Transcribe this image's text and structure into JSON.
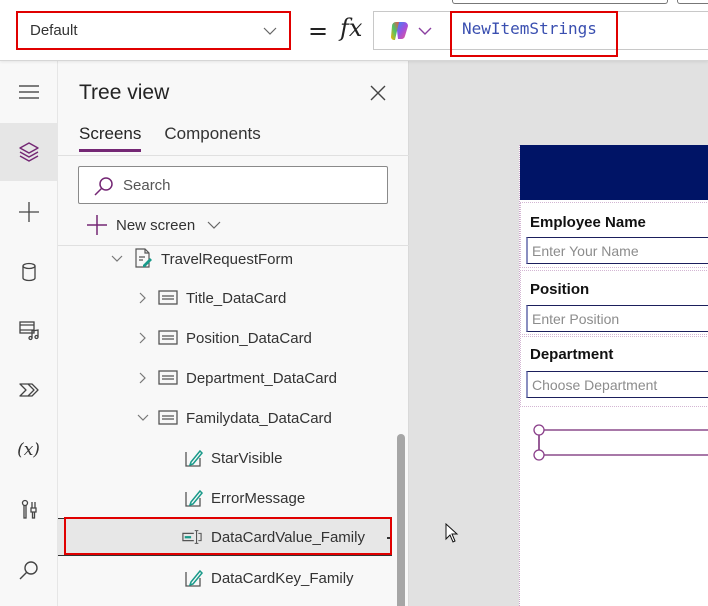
{
  "formula_bar": {
    "property_dropdown": "Default",
    "equals": "=",
    "fx": "fx",
    "formula": "NewItemStrings"
  },
  "rail": {
    "items": [
      {
        "name": "menu",
        "icon": "hamburger-icon"
      },
      {
        "name": "tree-view",
        "icon": "layers-icon",
        "active": true
      },
      {
        "name": "insert",
        "icon": "plus-icon"
      },
      {
        "name": "data",
        "icon": "database-icon"
      },
      {
        "name": "media",
        "icon": "media-icon"
      },
      {
        "name": "power-automate",
        "icon": "power-automate-icon"
      },
      {
        "name": "variables",
        "icon": "variables-icon",
        "glyph": "(x)"
      },
      {
        "name": "advanced-tools",
        "icon": "tools-icon"
      },
      {
        "name": "search",
        "icon": "search-icon"
      }
    ]
  },
  "tree": {
    "title": "Tree view",
    "tabs": [
      {
        "label": "Screens",
        "active": true
      },
      {
        "label": "Components",
        "active": false
      }
    ],
    "search_placeholder": "Search",
    "new_screen_label": "New screen",
    "rows": [
      {
        "label": "TravelRequestForm",
        "icon": "form-icon",
        "expanded": true
      },
      {
        "label": "Title_DataCard",
        "icon": "datacard-icon",
        "expanded": false
      },
      {
        "label": "Position_DataCard",
        "icon": "datacard-icon",
        "expanded": false
      },
      {
        "label": "Department_DataCard",
        "icon": "datacard-icon",
        "expanded": false
      },
      {
        "label": "Familydata_DataCard",
        "icon": "datacard-icon",
        "expanded": true
      },
      {
        "label": "StarVisible",
        "icon": "label-edit-icon"
      },
      {
        "label": "ErrorMessage",
        "icon": "label-edit-icon"
      },
      {
        "label": "DataCardValue_Family",
        "icon": "text-input-icon",
        "selected": true
      },
      {
        "label": "DataCardKey_Family",
        "icon": "label-edit-icon"
      }
    ]
  },
  "canvas": {
    "header_color": "#001466",
    "cards": [
      {
        "label": "Employee Name",
        "placeholder": "Enter Your Name"
      },
      {
        "label": "Position",
        "placeholder": "Enter Position"
      },
      {
        "label": "Department",
        "placeholder": "Choose Department"
      }
    ]
  },
  "colors": {
    "accent": "#742774",
    "highlight_outline": "#e00000",
    "formula_text": "#3a4fb0"
  }
}
